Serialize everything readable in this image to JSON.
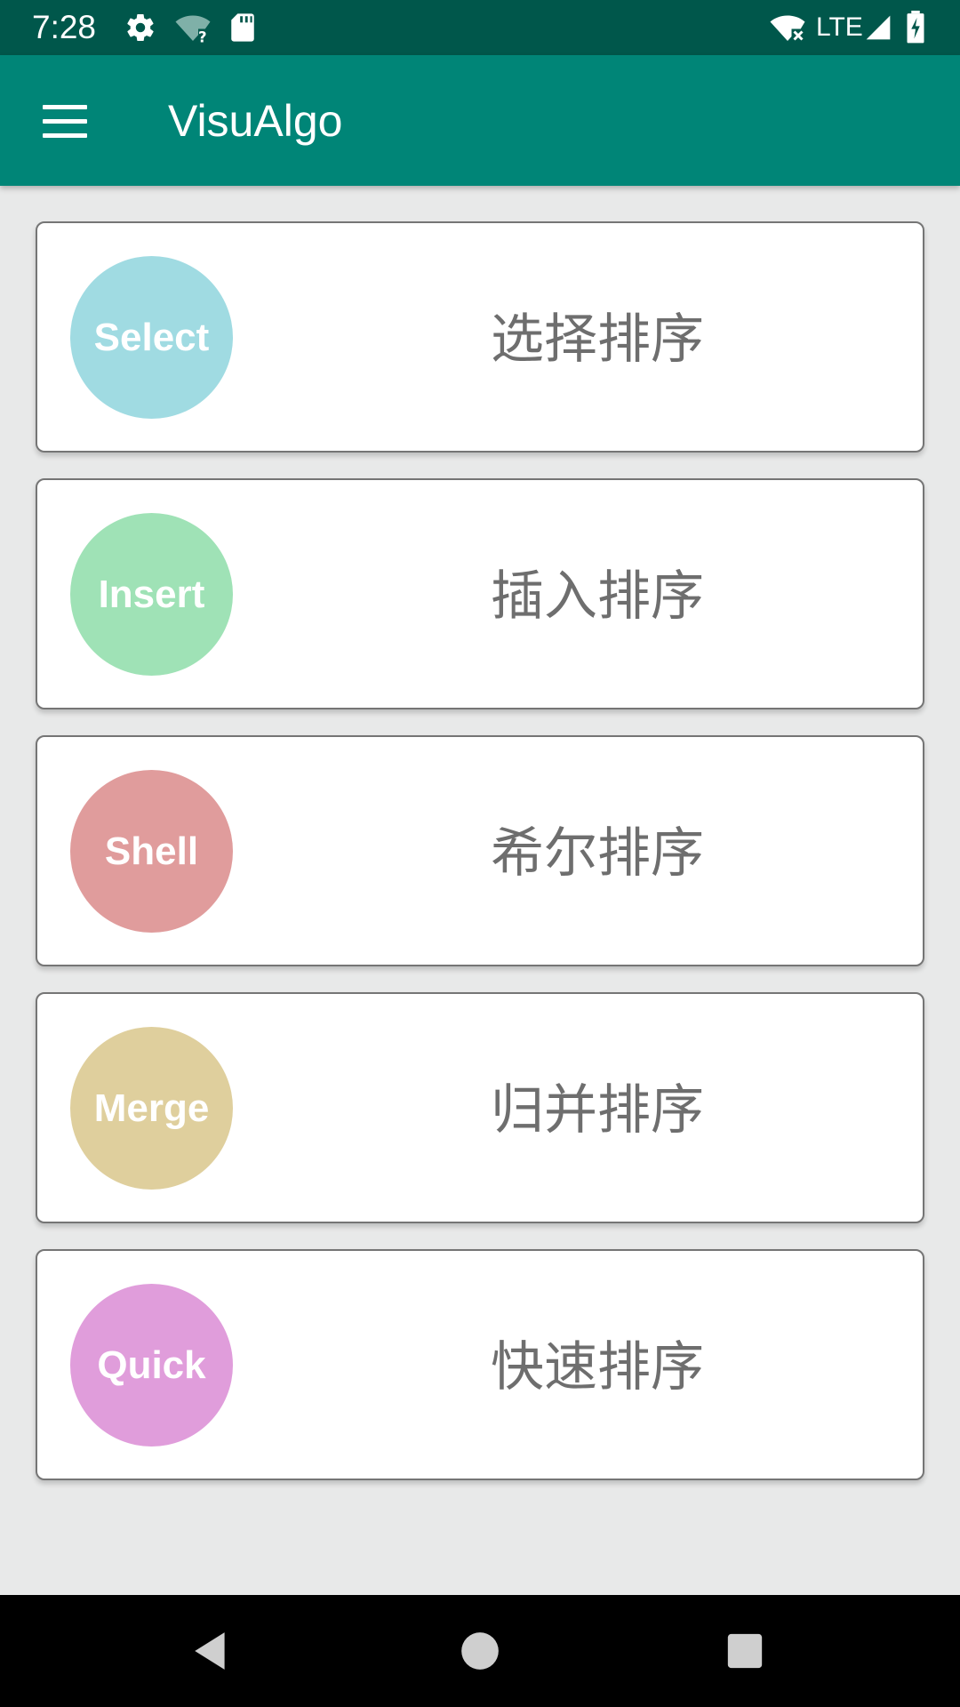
{
  "status_bar": {
    "time": "7:28",
    "network": "LTE",
    "icons": [
      "settings-icon",
      "wifi-unknown-icon",
      "sd-card-icon",
      "wifi-x-icon",
      "signal-icon",
      "battery-charging-icon"
    ]
  },
  "app_bar": {
    "title": "VisuAlgo",
    "menu_icon": "hamburger-menu-icon"
  },
  "algorithms": [
    {
      "badge": "Select",
      "label": "选择排序",
      "color": "#a0dbe2"
    },
    {
      "badge": "Insert",
      "label": "插入排序",
      "color": "#9fe2b6"
    },
    {
      "badge": "Shell",
      "label": "希尔排序",
      "color": "#e09c9c"
    },
    {
      "badge": "Merge",
      "label": "归并排序",
      "color": "#dfcf9d"
    },
    {
      "badge": "Quick",
      "label": "快速排序",
      "color": "#e09ddb"
    }
  ],
  "nav_bar": {
    "icons": [
      "back-icon",
      "home-icon",
      "recents-icon"
    ]
  }
}
